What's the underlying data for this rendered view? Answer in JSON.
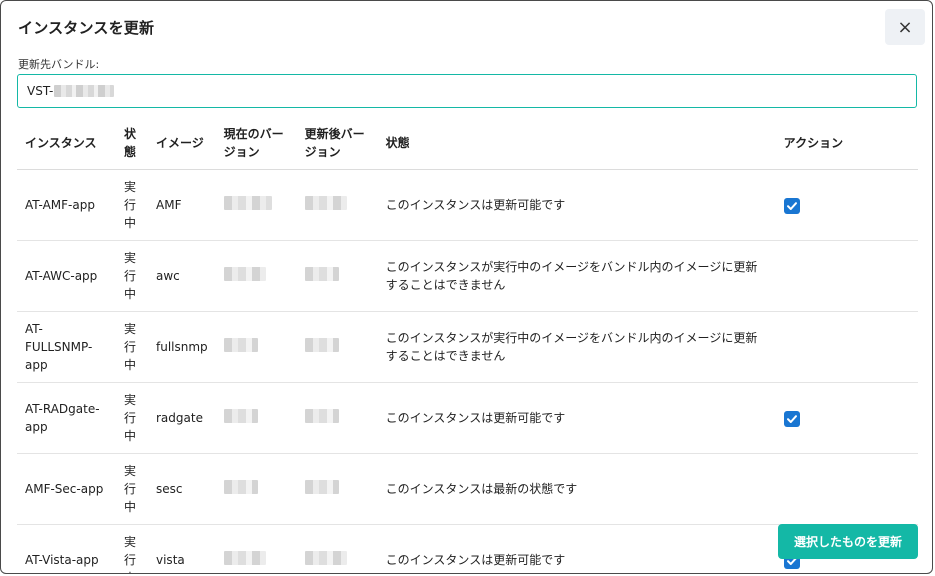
{
  "dialog": {
    "title": "インスタンスを更新",
    "close_label": "×"
  },
  "bundle": {
    "label": "更新先バンドル:",
    "value_prefix": "VST-"
  },
  "table": {
    "headers": [
      "インスタンス",
      "状態",
      "イメージ",
      "現在のバージョン",
      "更新後バージョン",
      "状態",
      "アクション"
    ],
    "rows": [
      {
        "instance": "AT-AMF-app",
        "state": "実行中",
        "image": "AMF",
        "status": "このインスタンスは更新可能です",
        "checked": true
      },
      {
        "instance": "AT-AWC-app",
        "state": "実行中",
        "image": "awc",
        "status": "このインスタンスが実行中のイメージをバンドル内のイメージに更新することはできません",
        "checked": false
      },
      {
        "instance": "AT-FULLSNMP-app",
        "state": "実行中",
        "image": "fullsnmp",
        "status": "このインスタンスが実行中のイメージをバンドル内のイメージに更新することはできません",
        "checked": false
      },
      {
        "instance": "AT-RADgate-app",
        "state": "実行中",
        "image": "radgate",
        "status": "このインスタンスは更新可能です",
        "checked": true
      },
      {
        "instance": "AMF-Sec-app",
        "state": "実行中",
        "image": "sesc",
        "status": "このインスタンスは最新の状態です",
        "checked": false
      },
      {
        "instance": "AT-Vista-app",
        "state": "実行中",
        "image": "vista",
        "status": "このインスタンスは更新可能です",
        "checked": true
      }
    ]
  },
  "footer": {
    "submit_label": "選択したものを更新"
  },
  "colors": {
    "accent": "#14b8a6",
    "checkbox": "#1976d2"
  },
  "icons": {
    "close": "close-icon",
    "check": "checkmark-icon"
  }
}
